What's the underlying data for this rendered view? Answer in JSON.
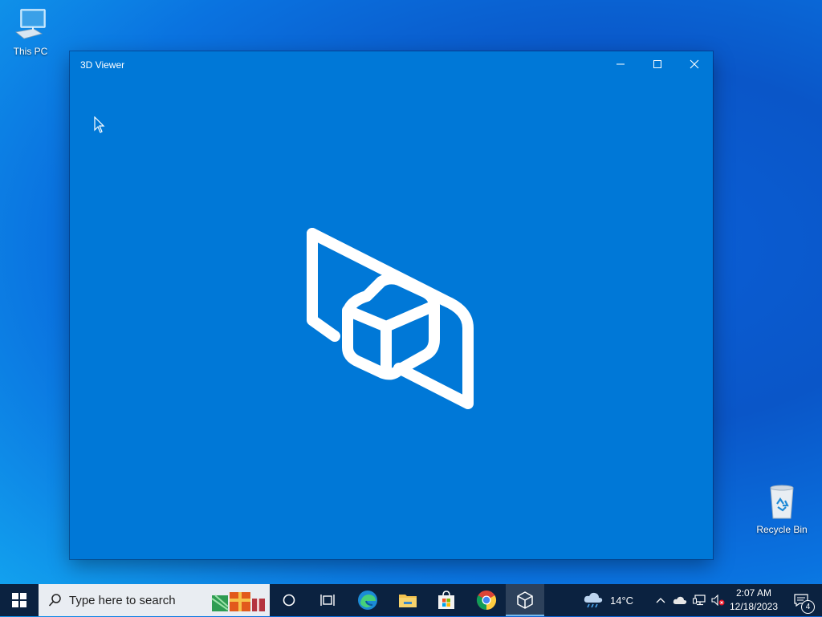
{
  "desktop": {
    "icons": [
      {
        "label": "This PC",
        "icon": "computer-icon"
      },
      {
        "label": "Recycle Bin",
        "icon": "recycle-bin-icon"
      }
    ]
  },
  "window": {
    "title": "3D Viewer",
    "background_color": "#0078d7",
    "controls": {
      "minimize": "minimize-icon",
      "maximize": "maximize-icon",
      "close": "close-icon"
    },
    "splash_logo": "3d-viewer-logo"
  },
  "taskbar": {
    "search_placeholder": "Type here to search",
    "pinned": [
      "start-icon",
      "cortana-icon",
      "task-view-icon",
      "edge-icon",
      "file-explorer-icon",
      "microsoft-store-icon",
      "chrome-icon",
      "3d-viewer-icon"
    ],
    "active_app": "3D Viewer",
    "weather": {
      "temp": "14°C",
      "icon": "rain-cloud-icon"
    },
    "tray_icons": [
      "chevron-up-icon",
      "onedrive-icon",
      "network-icon",
      "volume-muted-icon"
    ],
    "clock": {
      "time": "2:07 AM",
      "date": "12/18/2023"
    },
    "notifications": {
      "count": "4"
    }
  },
  "colors": {
    "taskbar": "#0b2240",
    "accent": "#0078d7",
    "desktop": "#0a5fd6"
  }
}
